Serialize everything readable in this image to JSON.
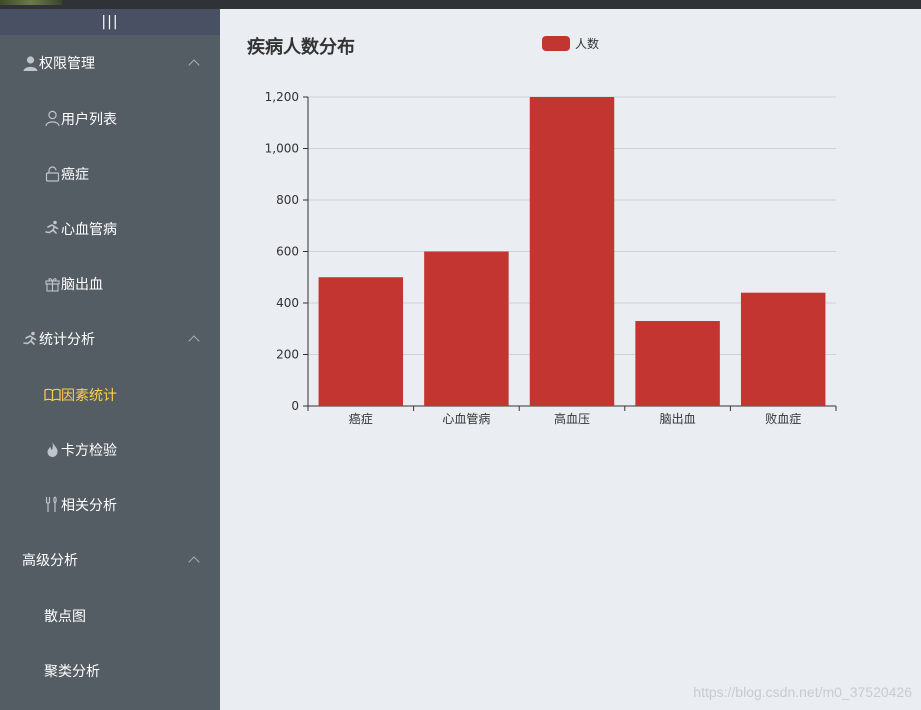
{
  "sidebar": {
    "collapse_label": "|||",
    "groups": [
      {
        "label": "权限管理",
        "icon": "user-icon",
        "items": [
          {
            "label": "用户列表",
            "icon": "user-outline-icon"
          },
          {
            "label": "癌症",
            "icon": "lock-icon"
          },
          {
            "label": "心血管病",
            "icon": "running-icon"
          },
          {
            "label": "脑出血",
            "icon": "gift-icon"
          }
        ]
      },
      {
        "label": "统计分析",
        "icon": "running-icon",
        "items": [
          {
            "label": "因素统计",
            "icon": "book-icon",
            "active": true
          },
          {
            "label": "卡方检验",
            "icon": "fire-icon"
          },
          {
            "label": "相关分析",
            "icon": "tools-icon"
          }
        ]
      },
      {
        "label": "高级分析",
        "icon": "",
        "items": [
          {
            "label": "散点图",
            "icon": ""
          },
          {
            "label": "聚类分析",
            "icon": ""
          }
        ]
      }
    ]
  },
  "chart": {
    "title": "疾病人数分布",
    "legend": "人数"
  },
  "chart_data": {
    "type": "bar",
    "title": "疾病人数分布",
    "categories": [
      "癌症",
      "心血管病",
      "高血压",
      "脑出血",
      "败血症"
    ],
    "series": [
      {
        "name": "人数",
        "values": [
          500,
          600,
          1200,
          330,
          440
        ],
        "color": "#c23531"
      }
    ],
    "ylim": [
      0,
      1200
    ],
    "yticks": [
      "0",
      "200",
      "400",
      "600",
      "800",
      "1,000",
      "1,200"
    ],
    "grid": true,
    "legend_position": "top"
  },
  "watermark": "https://blog.csdn.net/m0_37520426",
  "colors": {
    "sidebar_bg": "#545c64",
    "active": "#ffd04b",
    "bar": "#c23531",
    "main_bg": "#eaedf1"
  }
}
